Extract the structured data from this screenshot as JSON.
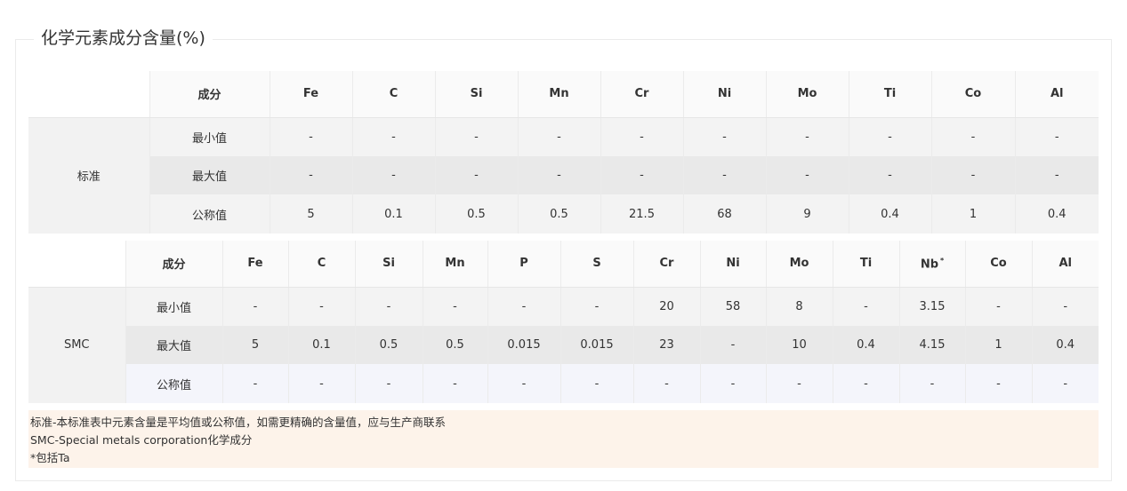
{
  "section_title": "化学元素成分含量(%)",
  "table1": {
    "header_label": "成分",
    "elements": [
      "Fe",
      "C",
      "Si",
      "Mn",
      "Cr",
      "Ni",
      "Mo",
      "Ti",
      "Co",
      "Al"
    ],
    "group": "标准",
    "rows": [
      {
        "label": "最小值",
        "values": [
          "-",
          "-",
          "-",
          "-",
          "-",
          "-",
          "-",
          "-",
          "-",
          "-"
        ]
      },
      {
        "label": "最大值",
        "values": [
          "-",
          "-",
          "-",
          "-",
          "-",
          "-",
          "-",
          "-",
          "-",
          "-"
        ]
      },
      {
        "label": "公称值",
        "values": [
          "5",
          "0.1",
          "0.5",
          "0.5",
          "21.5",
          "68",
          "9",
          "0.4",
          "1",
          "0.4"
        ]
      }
    ]
  },
  "table2": {
    "header_label": "成分",
    "elements": [
      "Fe",
      "C",
      "Si",
      "Mn",
      "P",
      "S",
      "Cr",
      "Ni",
      "Mo",
      "Ti",
      "Nb",
      "Co",
      "Al"
    ],
    "nb_footnote_mark": "*",
    "group": "SMC",
    "rows": [
      {
        "label": "最小值",
        "values": [
          "-",
          "-",
          "-",
          "-",
          "-",
          "-",
          "20",
          "58",
          "8",
          "-",
          "3.15",
          "-",
          "-"
        ]
      },
      {
        "label": "最大值",
        "values": [
          "5",
          "0.1",
          "0.5",
          "0.5",
          "0.015",
          "0.015",
          "23",
          "-",
          "10",
          "0.4",
          "4.15",
          "1",
          "0.4"
        ]
      },
      {
        "label": "公称值",
        "values": [
          "-",
          "-",
          "-",
          "-",
          "-",
          "-",
          "-",
          "-",
          "-",
          "-",
          "-",
          "-",
          "-"
        ]
      }
    ]
  },
  "notes": [
    "标准-本标准表中元素含量是平均值或公称值，如需更精确的含量值，应与生产商联系",
    "SMC-Special metals corporation化学成分",
    "*包括Ta"
  ]
}
